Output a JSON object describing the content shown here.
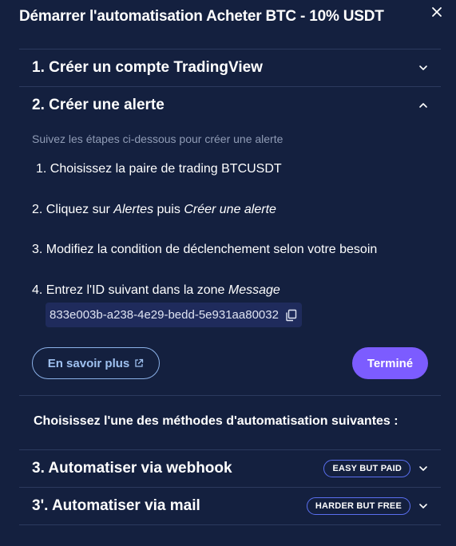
{
  "dialog": {
    "title": "Démarrer l'automatisation Acheter BTC - 10% USDT"
  },
  "sections": {
    "s1": {
      "label": "1. Créer un compte TradingView",
      "chevron": "chevron-down-icon"
    },
    "s2": {
      "label": "2. Créer une alerte",
      "chevron": "chevron-up-icon"
    },
    "s3": {
      "label": "3. Automatiser via webhook",
      "badge": "EASY BUT PAID",
      "chevron": "chevron-down-icon"
    },
    "s3b": {
      "label": "3'. Automatiser via mail",
      "badge": "HARDER BUT FREE",
      "chevron": "chevron-down-icon"
    }
  },
  "alert": {
    "intro": "Suivez les étapes ci-dessous pour créer une alerte",
    "step1": "1. Choisissez la paire de trading BTCUSDT",
    "step2_prefix": "2. Cliquez sur ",
    "step2_em1": "Alertes",
    "step2_mid": " puis ",
    "step2_em2": "Créer une alerte",
    "step3": "3. Modifiez la condition de déclenchement selon votre besoin",
    "step4_prefix": "4. Entrez l'ID suivant dans la zone ",
    "step4_em": "Message",
    "alert_id": "833e003b-a238-4e29-bedd-5e931aa80032",
    "learn_more": "En savoir plus",
    "done": "Terminé"
  },
  "methods": {
    "heading": "Choisissez l'une des méthodes d'automatisation suivantes :"
  },
  "colors": {
    "background": "#14203f",
    "accent": "#7c5cff",
    "link": "#9fc1f0",
    "divider": "#2c3a5e"
  }
}
